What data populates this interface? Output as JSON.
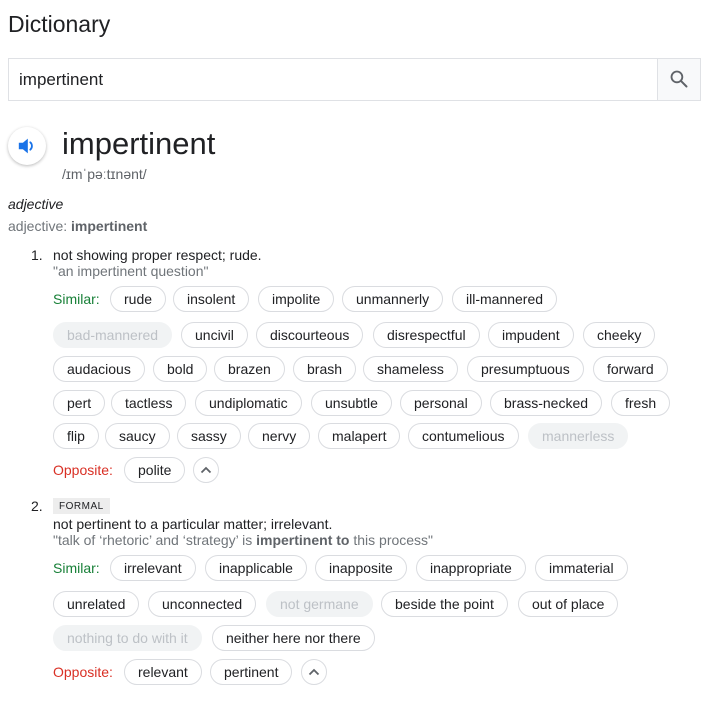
{
  "header": {
    "title": "Dictionary"
  },
  "search": {
    "value": "impertinent",
    "button_icon": "search-icon"
  },
  "entry": {
    "word": "impertinent",
    "phonetic": "/ɪmˈpəːtɪnənt/",
    "part_of_speech": "adjective",
    "pos_label": "adjective:",
    "pos_word": "impertinent"
  },
  "senses": [
    {
      "number": "1.",
      "definition": "not showing proper respect; rude.",
      "example": "\"an impertinent question\"",
      "similar_label": "Similar:",
      "opposite_label": "Opposite:",
      "similar": [
        "rude",
        "insolent",
        "impolite",
        "unmannerly",
        "ill-mannered",
        "bad-mannered",
        "uncivil",
        "discourteous",
        "disrespectful",
        "impudent",
        "cheeky",
        "audacious",
        "bold",
        "brazen",
        "brash",
        "shameless",
        "presumptuous",
        "forward",
        "pert",
        "tactless",
        "undiplomatic",
        "unsubtle",
        "personal",
        "brass-necked",
        "fresh",
        "flip",
        "saucy",
        "sassy",
        "nervy",
        "malapert",
        "contumelious",
        "mannerless"
      ],
      "opposite": [
        "polite"
      ]
    },
    {
      "number": "2.",
      "register": "FORMAL",
      "definition": "not pertinent to a particular matter; irrelevant.",
      "example_parts": [
        "\"talk of ‘rhetoric’ and ‘strategy’ is ",
        "impertinent to",
        " this process\""
      ],
      "similar_label": "Similar:",
      "opposite_label": "Opposite:",
      "similar": [
        "irrelevant",
        "inapplicable",
        "inapposite",
        "inappropriate",
        "immaterial",
        "unrelated",
        "unconnected",
        "not germane",
        "beside the point",
        "out of place",
        "nothing to do with it",
        "neither here nor there"
      ],
      "opposite": [
        "relevant",
        "pertinent"
      ]
    }
  ],
  "colors": {
    "similar": "#188038",
    "opposite": "#d93025",
    "speaker": "#1a73e8"
  }
}
